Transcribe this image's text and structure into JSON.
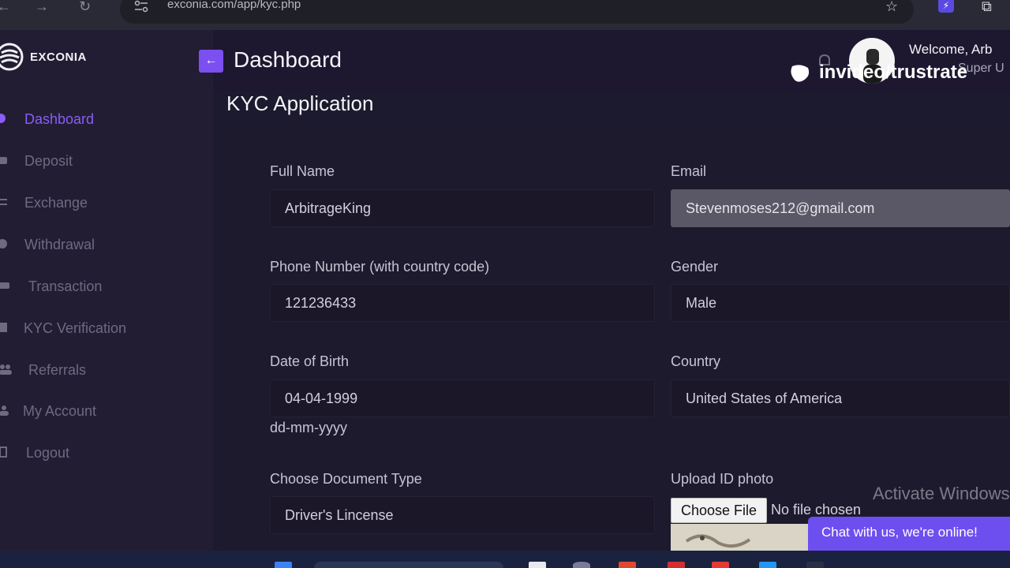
{
  "browser": {
    "url": "exconia.com/app/kyc.php"
  },
  "brand": {
    "name": "EXCONIA",
    "accent_color": "#8b5cf6"
  },
  "sidebar": {
    "items": [
      {
        "label": "Dashboard",
        "icon": "dashboard-icon",
        "active": true
      },
      {
        "label": "Deposit",
        "icon": "deposit-icon",
        "active": false
      },
      {
        "label": "Exchange",
        "icon": "exchange-icon",
        "active": false
      },
      {
        "label": "Withdrawal",
        "icon": "withdrawal-icon",
        "active": false
      },
      {
        "label": "Transaction",
        "icon": "transaction-icon",
        "active": false
      },
      {
        "label": "KYC Verification",
        "icon": "kyc-icon",
        "active": false
      },
      {
        "label": "Referrals",
        "icon": "referrals-icon",
        "active": false
      },
      {
        "label": "My Account",
        "icon": "user-icon",
        "active": false
      },
      {
        "label": "Logout",
        "icon": "logout-icon",
        "active": false
      }
    ]
  },
  "header": {
    "title": "Dashboard",
    "welcome": "Welcome, Arb",
    "role": "Super U",
    "watermark": "invideo/trustrate"
  },
  "page": {
    "title": "KYC Application"
  },
  "form": {
    "full_name": {
      "label": "Full Name",
      "value": "ArbitrageKing"
    },
    "email": {
      "label": "Email",
      "value": "Stevenmoses212@gmail.com"
    },
    "phone": {
      "label": "Phone Number (with country code)",
      "value": "121236433"
    },
    "gender": {
      "label": "Gender",
      "value": "Male"
    },
    "dob": {
      "label": "Date of Birth",
      "value": "04-04-1999",
      "hint": "dd-mm-yyyy"
    },
    "country": {
      "label": "Country",
      "value": "United States of America"
    },
    "doc_type": {
      "label": "Choose Document Type",
      "value": "Driver's Lincense"
    },
    "upload": {
      "label": "Upload ID photo",
      "button": "Choose File",
      "status": "No file chosen"
    }
  },
  "overlay": {
    "activate": "Activate Windows",
    "chat": "Chat with us, we're online!"
  }
}
